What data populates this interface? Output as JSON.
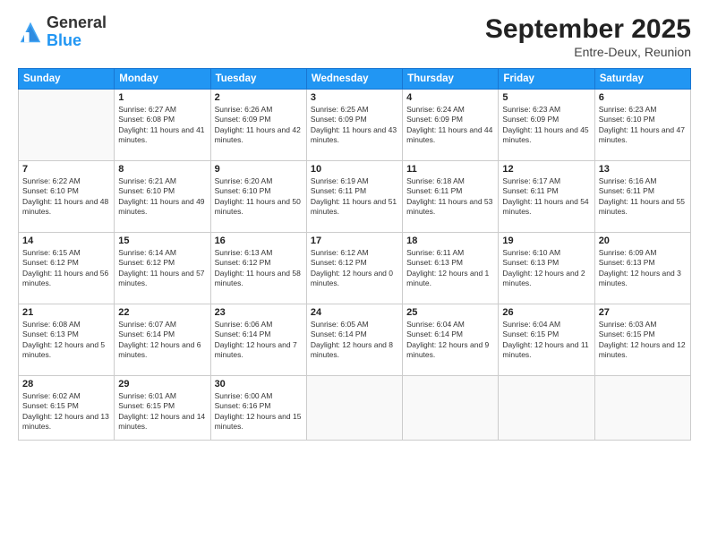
{
  "header": {
    "logo_general": "General",
    "logo_blue": "Blue",
    "month": "September 2025",
    "location": "Entre-Deux, Reunion"
  },
  "weekdays": [
    "Sunday",
    "Monday",
    "Tuesday",
    "Wednesday",
    "Thursday",
    "Friday",
    "Saturday"
  ],
  "weeks": [
    [
      {
        "day": "",
        "sunrise": "",
        "sunset": "",
        "daylight": ""
      },
      {
        "day": "1",
        "sunrise": "Sunrise: 6:27 AM",
        "sunset": "Sunset: 6:08 PM",
        "daylight": "Daylight: 11 hours and 41 minutes."
      },
      {
        "day": "2",
        "sunrise": "Sunrise: 6:26 AM",
        "sunset": "Sunset: 6:09 PM",
        "daylight": "Daylight: 11 hours and 42 minutes."
      },
      {
        "day": "3",
        "sunrise": "Sunrise: 6:25 AM",
        "sunset": "Sunset: 6:09 PM",
        "daylight": "Daylight: 11 hours and 43 minutes."
      },
      {
        "day": "4",
        "sunrise": "Sunrise: 6:24 AM",
        "sunset": "Sunset: 6:09 PM",
        "daylight": "Daylight: 11 hours and 44 minutes."
      },
      {
        "day": "5",
        "sunrise": "Sunrise: 6:23 AM",
        "sunset": "Sunset: 6:09 PM",
        "daylight": "Daylight: 11 hours and 45 minutes."
      },
      {
        "day": "6",
        "sunrise": "Sunrise: 6:23 AM",
        "sunset": "Sunset: 6:10 PM",
        "daylight": "Daylight: 11 hours and 47 minutes."
      }
    ],
    [
      {
        "day": "7",
        "sunrise": "Sunrise: 6:22 AM",
        "sunset": "Sunset: 6:10 PM",
        "daylight": "Daylight: 11 hours and 48 minutes."
      },
      {
        "day": "8",
        "sunrise": "Sunrise: 6:21 AM",
        "sunset": "Sunset: 6:10 PM",
        "daylight": "Daylight: 11 hours and 49 minutes."
      },
      {
        "day": "9",
        "sunrise": "Sunrise: 6:20 AM",
        "sunset": "Sunset: 6:10 PM",
        "daylight": "Daylight: 11 hours and 50 minutes."
      },
      {
        "day": "10",
        "sunrise": "Sunrise: 6:19 AM",
        "sunset": "Sunset: 6:11 PM",
        "daylight": "Daylight: 11 hours and 51 minutes."
      },
      {
        "day": "11",
        "sunrise": "Sunrise: 6:18 AM",
        "sunset": "Sunset: 6:11 PM",
        "daylight": "Daylight: 11 hours and 53 minutes."
      },
      {
        "day": "12",
        "sunrise": "Sunrise: 6:17 AM",
        "sunset": "Sunset: 6:11 PM",
        "daylight": "Daylight: 11 hours and 54 minutes."
      },
      {
        "day": "13",
        "sunrise": "Sunrise: 6:16 AM",
        "sunset": "Sunset: 6:11 PM",
        "daylight": "Daylight: 11 hours and 55 minutes."
      }
    ],
    [
      {
        "day": "14",
        "sunrise": "Sunrise: 6:15 AM",
        "sunset": "Sunset: 6:12 PM",
        "daylight": "Daylight: 11 hours and 56 minutes."
      },
      {
        "day": "15",
        "sunrise": "Sunrise: 6:14 AM",
        "sunset": "Sunset: 6:12 PM",
        "daylight": "Daylight: 11 hours and 57 minutes."
      },
      {
        "day": "16",
        "sunrise": "Sunrise: 6:13 AM",
        "sunset": "Sunset: 6:12 PM",
        "daylight": "Daylight: 11 hours and 58 minutes."
      },
      {
        "day": "17",
        "sunrise": "Sunrise: 6:12 AM",
        "sunset": "Sunset: 6:12 PM",
        "daylight": "Daylight: 12 hours and 0 minutes."
      },
      {
        "day": "18",
        "sunrise": "Sunrise: 6:11 AM",
        "sunset": "Sunset: 6:13 PM",
        "daylight": "Daylight: 12 hours and 1 minute."
      },
      {
        "day": "19",
        "sunrise": "Sunrise: 6:10 AM",
        "sunset": "Sunset: 6:13 PM",
        "daylight": "Daylight: 12 hours and 2 minutes."
      },
      {
        "day": "20",
        "sunrise": "Sunrise: 6:09 AM",
        "sunset": "Sunset: 6:13 PM",
        "daylight": "Daylight: 12 hours and 3 minutes."
      }
    ],
    [
      {
        "day": "21",
        "sunrise": "Sunrise: 6:08 AM",
        "sunset": "Sunset: 6:13 PM",
        "daylight": "Daylight: 12 hours and 5 minutes."
      },
      {
        "day": "22",
        "sunrise": "Sunrise: 6:07 AM",
        "sunset": "Sunset: 6:14 PM",
        "daylight": "Daylight: 12 hours and 6 minutes."
      },
      {
        "day": "23",
        "sunrise": "Sunrise: 6:06 AM",
        "sunset": "Sunset: 6:14 PM",
        "daylight": "Daylight: 12 hours and 7 minutes."
      },
      {
        "day": "24",
        "sunrise": "Sunrise: 6:05 AM",
        "sunset": "Sunset: 6:14 PM",
        "daylight": "Daylight: 12 hours and 8 minutes."
      },
      {
        "day": "25",
        "sunrise": "Sunrise: 6:04 AM",
        "sunset": "Sunset: 6:14 PM",
        "daylight": "Daylight: 12 hours and 9 minutes."
      },
      {
        "day": "26",
        "sunrise": "Sunrise: 6:04 AM",
        "sunset": "Sunset: 6:15 PM",
        "daylight": "Daylight: 12 hours and 11 minutes."
      },
      {
        "day": "27",
        "sunrise": "Sunrise: 6:03 AM",
        "sunset": "Sunset: 6:15 PM",
        "daylight": "Daylight: 12 hours and 12 minutes."
      }
    ],
    [
      {
        "day": "28",
        "sunrise": "Sunrise: 6:02 AM",
        "sunset": "Sunset: 6:15 PM",
        "daylight": "Daylight: 12 hours and 13 minutes."
      },
      {
        "day": "29",
        "sunrise": "Sunrise: 6:01 AM",
        "sunset": "Sunset: 6:15 PM",
        "daylight": "Daylight: 12 hours and 14 minutes."
      },
      {
        "day": "30",
        "sunrise": "Sunrise: 6:00 AM",
        "sunset": "Sunset: 6:16 PM",
        "daylight": "Daylight: 12 hours and 15 minutes."
      },
      {
        "day": "",
        "sunrise": "",
        "sunset": "",
        "daylight": ""
      },
      {
        "day": "",
        "sunrise": "",
        "sunset": "",
        "daylight": ""
      },
      {
        "day": "",
        "sunrise": "",
        "sunset": "",
        "daylight": ""
      },
      {
        "day": "",
        "sunrise": "",
        "sunset": "",
        "daylight": ""
      }
    ]
  ]
}
